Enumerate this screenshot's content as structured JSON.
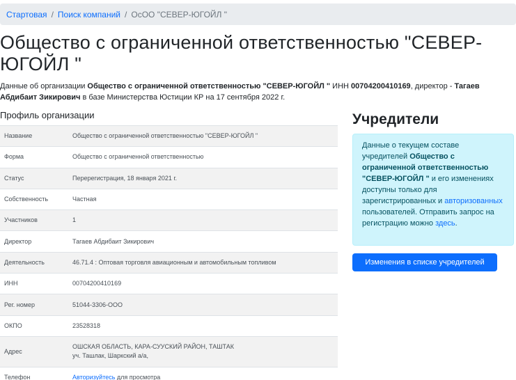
{
  "breadcrumb": {
    "home": "Стартовая",
    "search": "Поиск компаний",
    "current": "ОсОО \"СЕВЕР-ЮГОЙЛ \""
  },
  "page_title": "Общество с ограниченной ответственностью \"СЕВЕР-ЮГОЙЛ \"",
  "summary": {
    "intro": "Данные об организации ",
    "org_name": "Общество с ограниченной ответственностью \"СЕВЕР-ЮГОЙЛ \"",
    "inn_label": " ИНН ",
    "inn": "00704200410169",
    "director_label": ", директор - ",
    "director": "Тагаев Абдибаит Зикирович",
    "outro": " в базе Министерства Юстиции КР на 17 сентября 2022 г."
  },
  "profile": {
    "heading": "Профиль организации",
    "rows": [
      {
        "label": "Название",
        "value": "Общество с ограниченной ответственностью \"СЕВЕР-ЮГОЙЛ \""
      },
      {
        "label": "Форма",
        "value": "Общество с ограниченной ответственностью"
      },
      {
        "label": "Статус",
        "value": "Перерегистрация, 18 января 2021 г."
      },
      {
        "label": "Собственность",
        "value": "Частная"
      },
      {
        "label": "Участников",
        "value": "1"
      },
      {
        "label": "Директор",
        "value": "Тагаев Абдибаит Зикирович"
      },
      {
        "label": "Деятельность",
        "value": "46.71.4 : Оптовая  торговля авиационным и автомобильным топливом"
      },
      {
        "label": "ИНН",
        "value": "00704200410169"
      },
      {
        "label": "Рег. номер",
        "value": "51044-3306-ООО"
      },
      {
        "label": "ОКПО",
        "value": "23528318"
      },
      {
        "label": "Адрес",
        "line1": "ОШСКАЯ ОБЛАСТЬ, КАРА-СУУСКИЙ РАЙОН, ТАШТАК",
        "line2": "уч. Ташлак, Шаркский а/а,"
      },
      {
        "label": "Телефон",
        "link": "Авторизуйтесь",
        "suffix": " для просмотра"
      }
    ]
  },
  "founders": {
    "title": "Учредители",
    "alert": {
      "p1": "Данные о текущем составе учредителей ",
      "org": "Общество с ограниченной ответственностью \"СЕВЕР-ЮГОЙЛ \"",
      "p2": " и его изменениях доступны только для зарегистрированных и ",
      "link1": "авторизованных",
      "p3": " пользователей. Отправить запрос на регистрацию можно ",
      "link2": "здесь",
      "p4": "."
    },
    "button": "Изменения в списке учредителей"
  }
}
